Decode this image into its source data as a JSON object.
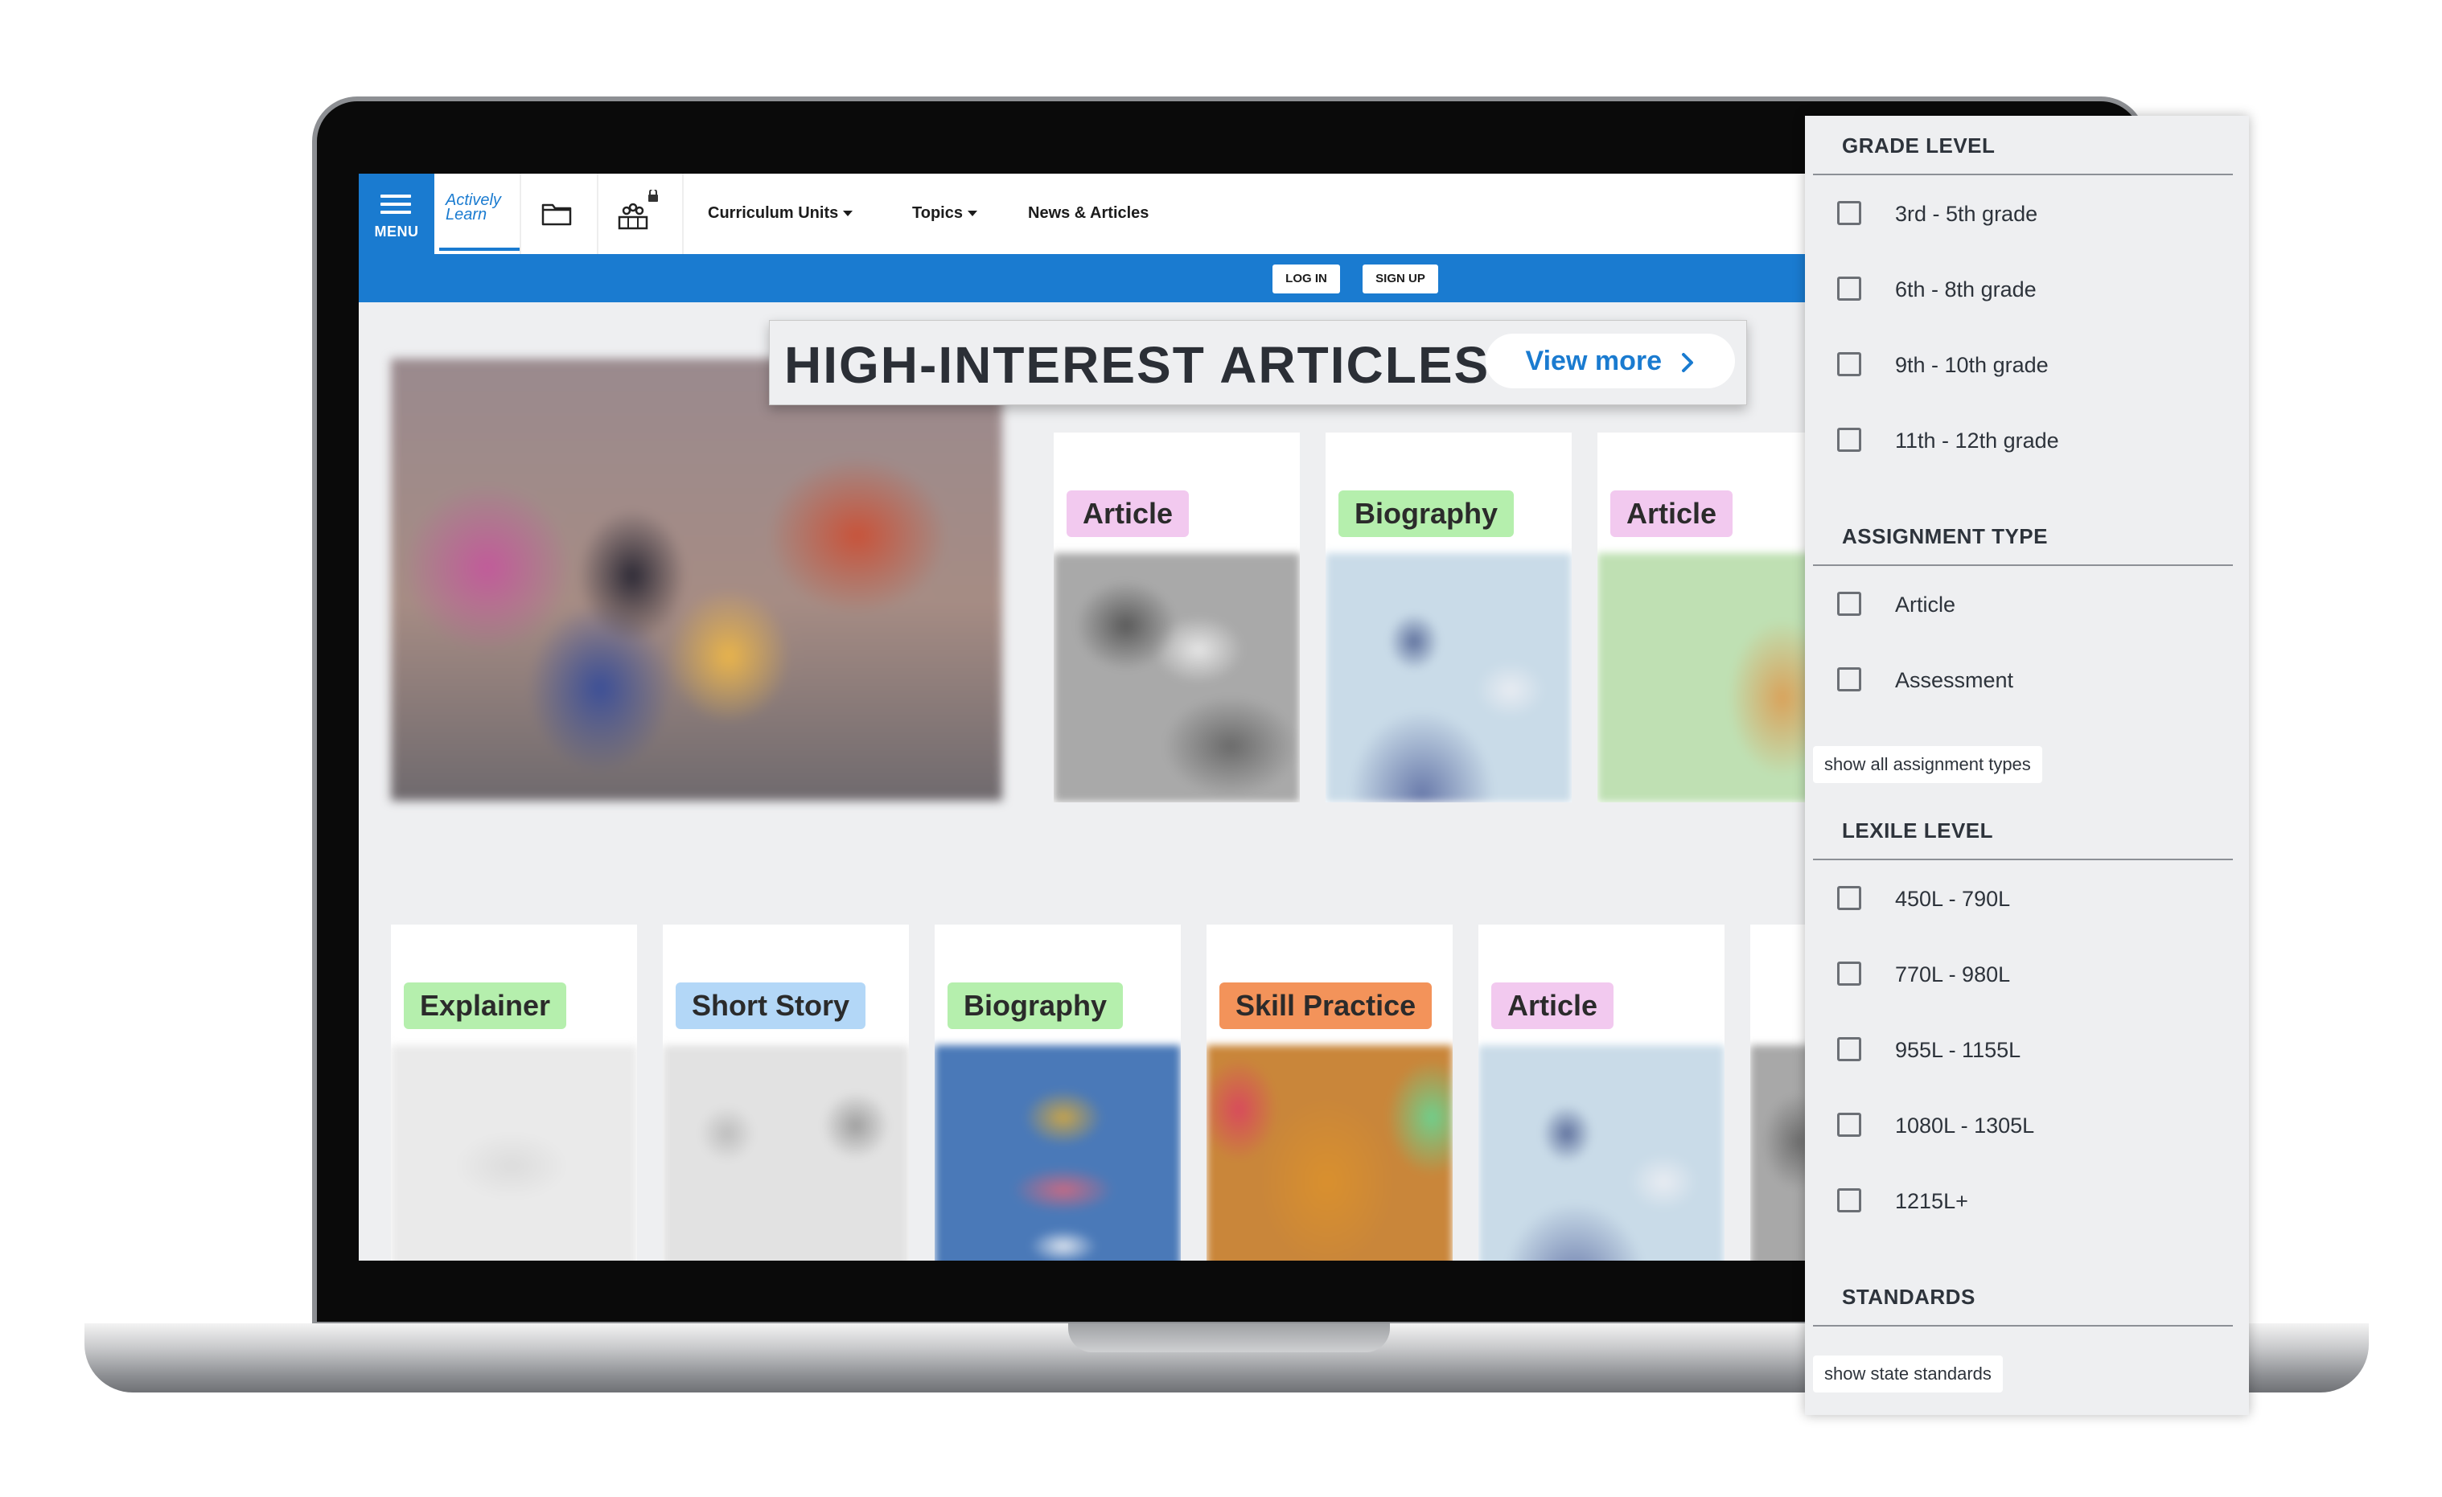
{
  "header": {
    "menu_label": "MENU",
    "logo_line1": "Actively",
    "logo_line2": "Learn",
    "nav": [
      {
        "label": "Curriculum Units"
      },
      {
        "label": "Topics"
      },
      {
        "label": "News & Articles"
      }
    ]
  },
  "auth": {
    "login": "LOG IN",
    "signup": "SIGN UP"
  },
  "hero": {
    "title": "HIGH-INTEREST ARTICLES",
    "view_more": "View more"
  },
  "top_cards": [
    {
      "tag": "Article",
      "tag_color": "#f2c9ef"
    },
    {
      "tag": "Biography",
      "tag_color": "#b5efad"
    },
    {
      "tag": "Article",
      "tag_color": "#f2c9ef"
    }
  ],
  "bottom_cards": [
    {
      "tag": "Explainer",
      "tag_color": "#b5efad"
    },
    {
      "tag": "Short Story",
      "tag_color": "#b3d7f7"
    },
    {
      "tag": "Biography",
      "tag_color": "#b5efad"
    },
    {
      "tag": "Skill Practice",
      "tag_color": "#f3935a"
    },
    {
      "tag": "Article",
      "tag_color": "#f2c9ef"
    }
  ],
  "filters": {
    "grade_level": {
      "heading": "GRADE LEVEL",
      "options": [
        "3rd - 5th grade",
        "6th - 8th grade",
        "9th - 10th grade",
        "11th - 12th grade"
      ]
    },
    "assignment_type": {
      "heading": "ASSIGNMENT TYPE",
      "options": [
        "Article",
        "Assessment"
      ],
      "show_all": "show all assignment types"
    },
    "lexile_level": {
      "heading": "LEXILE LEVEL",
      "options": [
        "450L - 790L",
        "770L - 980L",
        "955L - 1155L",
        "1080L - 1305L",
        "1215L+"
      ]
    },
    "standards": {
      "heading": "STANDARDS",
      "show_state": "show state standards"
    }
  },
  "colors": {
    "brand_blue": "#1a7bd0",
    "panel_bg": "#eeeff1"
  }
}
